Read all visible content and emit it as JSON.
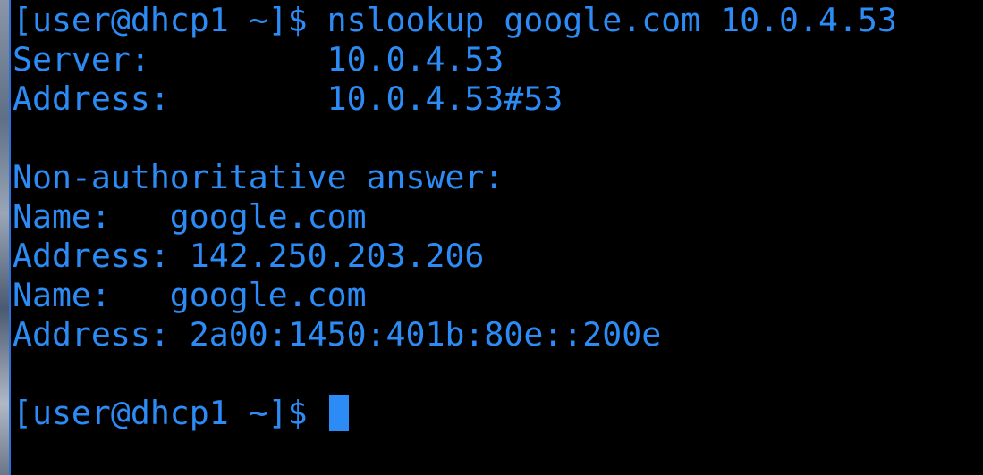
{
  "terminal": {
    "lines": [
      "[user@dhcp1 ~]$ nslookup google.com 10.0.4.53",
      "Server:         10.0.4.53",
      "Address:        10.0.4.53#53",
      "",
      "Non-authoritative answer:",
      "Name:   google.com",
      "Address: 142.250.203.206",
      "Name:   google.com",
      "Address: 2a00:1450:401b:80e::200e",
      "",
      "[user@dhcp1 ~]$ "
    ],
    "prompt": "[user@dhcp1 ~]$ "
  },
  "colors": {
    "background": "#000000",
    "text": "#2c8bf4",
    "cursor": "#2c8bf4"
  }
}
